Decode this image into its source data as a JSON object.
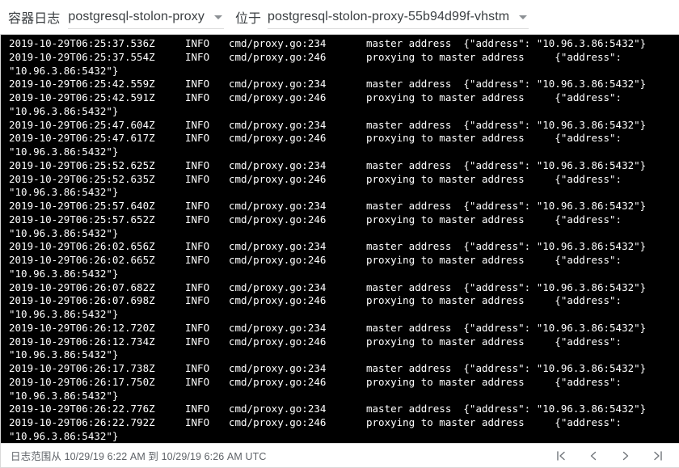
{
  "header": {
    "title_label": "容器日志",
    "container_select": {
      "value": "postgresql-stolon-proxy",
      "caret": "chevron-down-icon"
    },
    "in_label": "位于",
    "pod_select": {
      "value": "postgresql-stolon-proxy-55b94d99f-vhstm",
      "caret": "chevron-down-icon"
    }
  },
  "log": {
    "columns": [
      "timestamp",
      "severity",
      "source",
      "message"
    ],
    "entries": [
      {
        "timestamp": "2019-10-29T06:25:37.536Z",
        "severity": "INFO",
        "source": "cmd/proxy.go:234",
        "message": "master address  {\"address\": \"10.96.3.86:5432\"}"
      },
      {
        "timestamp": "2019-10-29T06:25:37.554Z",
        "severity": "INFO",
        "source": "cmd/proxy.go:246",
        "message": "proxying to master address     {\"address\":",
        "continuation": "\"10.96.3.86:5432\"}"
      },
      {
        "timestamp": "2019-10-29T06:25:42.559Z",
        "severity": "INFO",
        "source": "cmd/proxy.go:234",
        "message": "master address  {\"address\": \"10.96.3.86:5432\"}"
      },
      {
        "timestamp": "2019-10-29T06:25:42.591Z",
        "severity": "INFO",
        "source": "cmd/proxy.go:246",
        "message": "proxying to master address     {\"address\":",
        "continuation": "\"10.96.3.86:5432\"}"
      },
      {
        "timestamp": "2019-10-29T06:25:47.604Z",
        "severity": "INFO",
        "source": "cmd/proxy.go:234",
        "message": "master address  {\"address\": \"10.96.3.86:5432\"}"
      },
      {
        "timestamp": "2019-10-29T06:25:47.617Z",
        "severity": "INFO",
        "source": "cmd/proxy.go:246",
        "message": "proxying to master address     {\"address\":",
        "continuation": "\"10.96.3.86:5432\"}"
      },
      {
        "timestamp": "2019-10-29T06:25:52.625Z",
        "severity": "INFO",
        "source": "cmd/proxy.go:234",
        "message": "master address  {\"address\": \"10.96.3.86:5432\"}"
      },
      {
        "timestamp": "2019-10-29T06:25:52.635Z",
        "severity": "INFO",
        "source": "cmd/proxy.go:246",
        "message": "proxying to master address     {\"address\":",
        "continuation": "\"10.96.3.86:5432\"}"
      },
      {
        "timestamp": "2019-10-29T06:25:57.640Z",
        "severity": "INFO",
        "source": "cmd/proxy.go:234",
        "message": "master address  {\"address\": \"10.96.3.86:5432\"}"
      },
      {
        "timestamp": "2019-10-29T06:25:57.652Z",
        "severity": "INFO",
        "source": "cmd/proxy.go:246",
        "message": "proxying to master address     {\"address\":",
        "continuation": "\"10.96.3.86:5432\"}"
      },
      {
        "timestamp": "2019-10-29T06:26:02.656Z",
        "severity": "INFO",
        "source": "cmd/proxy.go:234",
        "message": "master address  {\"address\": \"10.96.3.86:5432\"}"
      },
      {
        "timestamp": "2019-10-29T06:26:02.665Z",
        "severity": "INFO",
        "source": "cmd/proxy.go:246",
        "message": "proxying to master address     {\"address\":",
        "continuation": "\"10.96.3.86:5432\"}"
      },
      {
        "timestamp": "2019-10-29T06:26:07.682Z",
        "severity": "INFO",
        "source": "cmd/proxy.go:234",
        "message": "master address  {\"address\": \"10.96.3.86:5432\"}"
      },
      {
        "timestamp": "2019-10-29T06:26:07.698Z",
        "severity": "INFO",
        "source": "cmd/proxy.go:246",
        "message": "proxying to master address     {\"address\":",
        "continuation": "\"10.96.3.86:5432\"}"
      },
      {
        "timestamp": "2019-10-29T06:26:12.720Z",
        "severity": "INFO",
        "source": "cmd/proxy.go:234",
        "message": "master address  {\"address\": \"10.96.3.86:5432\"}"
      },
      {
        "timestamp": "2019-10-29T06:26:12.734Z",
        "severity": "INFO",
        "source": "cmd/proxy.go:246",
        "message": "proxying to master address     {\"address\":",
        "continuation": "\"10.96.3.86:5432\"}"
      },
      {
        "timestamp": "2019-10-29T06:26:17.738Z",
        "severity": "INFO",
        "source": "cmd/proxy.go:234",
        "message": "master address  {\"address\": \"10.96.3.86:5432\"}"
      },
      {
        "timestamp": "2019-10-29T06:26:17.750Z",
        "severity": "INFO",
        "source": "cmd/proxy.go:246",
        "message": "proxying to master address     {\"address\":",
        "continuation": "\"10.96.3.86:5432\"}"
      },
      {
        "timestamp": "2019-10-29T06:26:22.776Z",
        "severity": "INFO",
        "source": "cmd/proxy.go:234",
        "message": "master address  {\"address\": \"10.96.3.86:5432\"}"
      },
      {
        "timestamp": "2019-10-29T06:26:22.792Z",
        "severity": "INFO",
        "source": "cmd/proxy.go:246",
        "message": "proxying to master address     {\"address\":",
        "continuation": "\"10.96.3.86:5432\"}"
      }
    ]
  },
  "footer": {
    "range_text": "日志范围从 10/29/19 6:22 AM 到 10/29/19 6:26 AM UTC",
    "pager": [
      {
        "name": "first-page-icon"
      },
      {
        "name": "previous-page-icon"
      },
      {
        "name": "next-page-icon"
      },
      {
        "name": "last-page-icon"
      }
    ]
  },
  "colors": {
    "log_background": "#000000",
    "log_text": "#ffffff",
    "page_background": "#ffffff",
    "border": "#d9d9d9",
    "muted_text": "#5f6368"
  }
}
